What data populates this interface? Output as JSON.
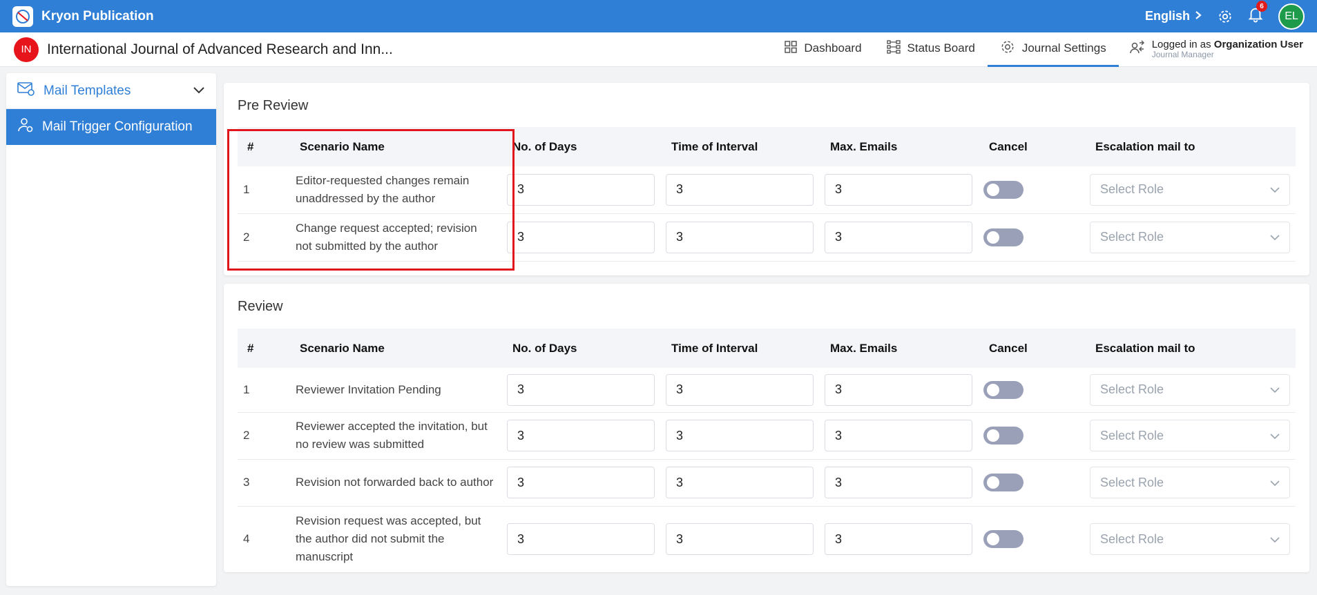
{
  "app": {
    "title": "Kryon Publication",
    "language": "English",
    "notification_count": "6",
    "user_initials": "EL"
  },
  "journal": {
    "initials": "IN",
    "title": "International Journal of Advanced Research and Inn..."
  },
  "nav": {
    "dashboard": "Dashboard",
    "status_board": "Status Board",
    "journal_settings": "Journal Settings",
    "logged_prefix": "Logged in as",
    "logged_user": "Organization User",
    "logged_role": "Journal Manager"
  },
  "sidebar": {
    "mail_templates": "Mail Templates",
    "mail_trigger": "Mail Trigger Configuration"
  },
  "columns": {
    "hash": "#",
    "scenario": "Scenario Name",
    "days": "No. of Days",
    "interval": "Time of Interval",
    "max": "Max. Emails",
    "cancel": "Cancel",
    "escalation": "Escalation mail to"
  },
  "pre_review": {
    "title": "Pre Review",
    "rows": [
      {
        "num": "1",
        "scenario": "Editor-requested changes remain unaddressed by the author",
        "days": "3",
        "interval": "3",
        "max": "3",
        "escalation": "Select Role"
      },
      {
        "num": "2",
        "scenario": "Change request accepted; revision not submitted by the author",
        "days": "3",
        "interval": "3",
        "max": "3",
        "escalation": "Select Role"
      }
    ]
  },
  "review": {
    "title": "Review",
    "rows": [
      {
        "num": "1",
        "scenario": "Reviewer Invitation Pending",
        "days": "3",
        "interval": "3",
        "max": "3",
        "escalation": "Select Role"
      },
      {
        "num": "2",
        "scenario": "Reviewer accepted the invitation, but no review was submitted",
        "days": "3",
        "interval": "3",
        "max": "3",
        "escalation": "Select Role"
      },
      {
        "num": "3",
        "scenario": "Revision not forwarded back to author",
        "days": "3",
        "interval": "3",
        "max": "3",
        "escalation": "Select Role"
      },
      {
        "num": "4",
        "scenario": "Revision request was accepted, but the author did not submit the manuscript",
        "days": "3",
        "interval": "3",
        "max": "3",
        "escalation": "Select Role"
      }
    ]
  },
  "colors": {
    "primary": "#2f7fd6",
    "highlight": "#e0161c",
    "toggle_off": "#9aa0b8"
  },
  "icons": [
    "app-logo-icon",
    "chevron-right-icon",
    "gear-icon",
    "bell-icon",
    "grid-icon",
    "status-board-icon",
    "settings-cog-icon",
    "user-switch-icon",
    "mail-settings-icon",
    "user-config-icon",
    "chevron-down-icon"
  ]
}
